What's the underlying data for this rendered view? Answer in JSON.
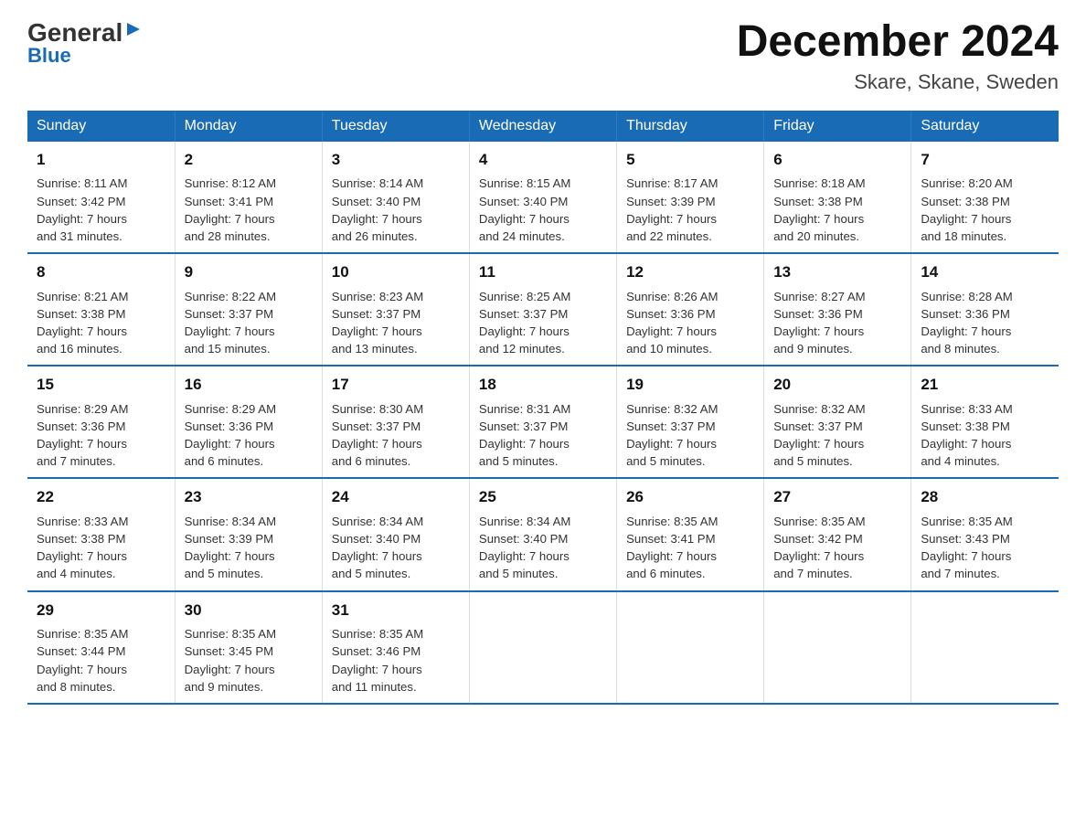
{
  "logo": {
    "general": "General",
    "blue": "Blue"
  },
  "title": "December 2024",
  "subtitle": "Skare, Skane, Sweden",
  "days_of_week": [
    "Sunday",
    "Monday",
    "Tuesday",
    "Wednesday",
    "Thursday",
    "Friday",
    "Saturday"
  ],
  "weeks": [
    [
      {
        "day": "1",
        "sunrise": "8:11 AM",
        "sunset": "3:42 PM",
        "daylight": "7 hours and 31 minutes."
      },
      {
        "day": "2",
        "sunrise": "8:12 AM",
        "sunset": "3:41 PM",
        "daylight": "7 hours and 28 minutes."
      },
      {
        "day": "3",
        "sunrise": "8:14 AM",
        "sunset": "3:40 PM",
        "daylight": "7 hours and 26 minutes."
      },
      {
        "day": "4",
        "sunrise": "8:15 AM",
        "sunset": "3:40 PM",
        "daylight": "7 hours and 24 minutes."
      },
      {
        "day": "5",
        "sunrise": "8:17 AM",
        "sunset": "3:39 PM",
        "daylight": "7 hours and 22 minutes."
      },
      {
        "day": "6",
        "sunrise": "8:18 AM",
        "sunset": "3:38 PM",
        "daylight": "7 hours and 20 minutes."
      },
      {
        "day": "7",
        "sunrise": "8:20 AM",
        "sunset": "3:38 PM",
        "daylight": "7 hours and 18 minutes."
      }
    ],
    [
      {
        "day": "8",
        "sunrise": "8:21 AM",
        "sunset": "3:38 PM",
        "daylight": "7 hours and 16 minutes."
      },
      {
        "day": "9",
        "sunrise": "8:22 AM",
        "sunset": "3:37 PM",
        "daylight": "7 hours and 15 minutes."
      },
      {
        "day": "10",
        "sunrise": "8:23 AM",
        "sunset": "3:37 PM",
        "daylight": "7 hours and 13 minutes."
      },
      {
        "day": "11",
        "sunrise": "8:25 AM",
        "sunset": "3:37 PM",
        "daylight": "7 hours and 12 minutes."
      },
      {
        "day": "12",
        "sunrise": "8:26 AM",
        "sunset": "3:36 PM",
        "daylight": "7 hours and 10 minutes."
      },
      {
        "day": "13",
        "sunrise": "8:27 AM",
        "sunset": "3:36 PM",
        "daylight": "7 hours and 9 minutes."
      },
      {
        "day": "14",
        "sunrise": "8:28 AM",
        "sunset": "3:36 PM",
        "daylight": "7 hours and 8 minutes."
      }
    ],
    [
      {
        "day": "15",
        "sunrise": "8:29 AM",
        "sunset": "3:36 PM",
        "daylight": "7 hours and 7 minutes."
      },
      {
        "day": "16",
        "sunrise": "8:29 AM",
        "sunset": "3:36 PM",
        "daylight": "7 hours and 6 minutes."
      },
      {
        "day": "17",
        "sunrise": "8:30 AM",
        "sunset": "3:37 PM",
        "daylight": "7 hours and 6 minutes."
      },
      {
        "day": "18",
        "sunrise": "8:31 AM",
        "sunset": "3:37 PM",
        "daylight": "7 hours and 5 minutes."
      },
      {
        "day": "19",
        "sunrise": "8:32 AM",
        "sunset": "3:37 PM",
        "daylight": "7 hours and 5 minutes."
      },
      {
        "day": "20",
        "sunrise": "8:32 AM",
        "sunset": "3:37 PM",
        "daylight": "7 hours and 5 minutes."
      },
      {
        "day": "21",
        "sunrise": "8:33 AM",
        "sunset": "3:38 PM",
        "daylight": "7 hours and 4 minutes."
      }
    ],
    [
      {
        "day": "22",
        "sunrise": "8:33 AM",
        "sunset": "3:38 PM",
        "daylight": "7 hours and 4 minutes."
      },
      {
        "day": "23",
        "sunrise": "8:34 AM",
        "sunset": "3:39 PM",
        "daylight": "7 hours and 5 minutes."
      },
      {
        "day": "24",
        "sunrise": "8:34 AM",
        "sunset": "3:40 PM",
        "daylight": "7 hours and 5 minutes."
      },
      {
        "day": "25",
        "sunrise": "8:34 AM",
        "sunset": "3:40 PM",
        "daylight": "7 hours and 5 minutes."
      },
      {
        "day": "26",
        "sunrise": "8:35 AM",
        "sunset": "3:41 PM",
        "daylight": "7 hours and 6 minutes."
      },
      {
        "day": "27",
        "sunrise": "8:35 AM",
        "sunset": "3:42 PM",
        "daylight": "7 hours and 7 minutes."
      },
      {
        "day": "28",
        "sunrise": "8:35 AM",
        "sunset": "3:43 PM",
        "daylight": "7 hours and 7 minutes."
      }
    ],
    [
      {
        "day": "29",
        "sunrise": "8:35 AM",
        "sunset": "3:44 PM",
        "daylight": "7 hours and 8 minutes."
      },
      {
        "day": "30",
        "sunrise": "8:35 AM",
        "sunset": "3:45 PM",
        "daylight": "7 hours and 9 minutes."
      },
      {
        "day": "31",
        "sunrise": "8:35 AM",
        "sunset": "3:46 PM",
        "daylight": "7 hours and 11 minutes."
      },
      null,
      null,
      null,
      null
    ]
  ],
  "labels": {
    "sunrise": "Sunrise:",
    "sunset": "Sunset:",
    "daylight": "Daylight:"
  }
}
